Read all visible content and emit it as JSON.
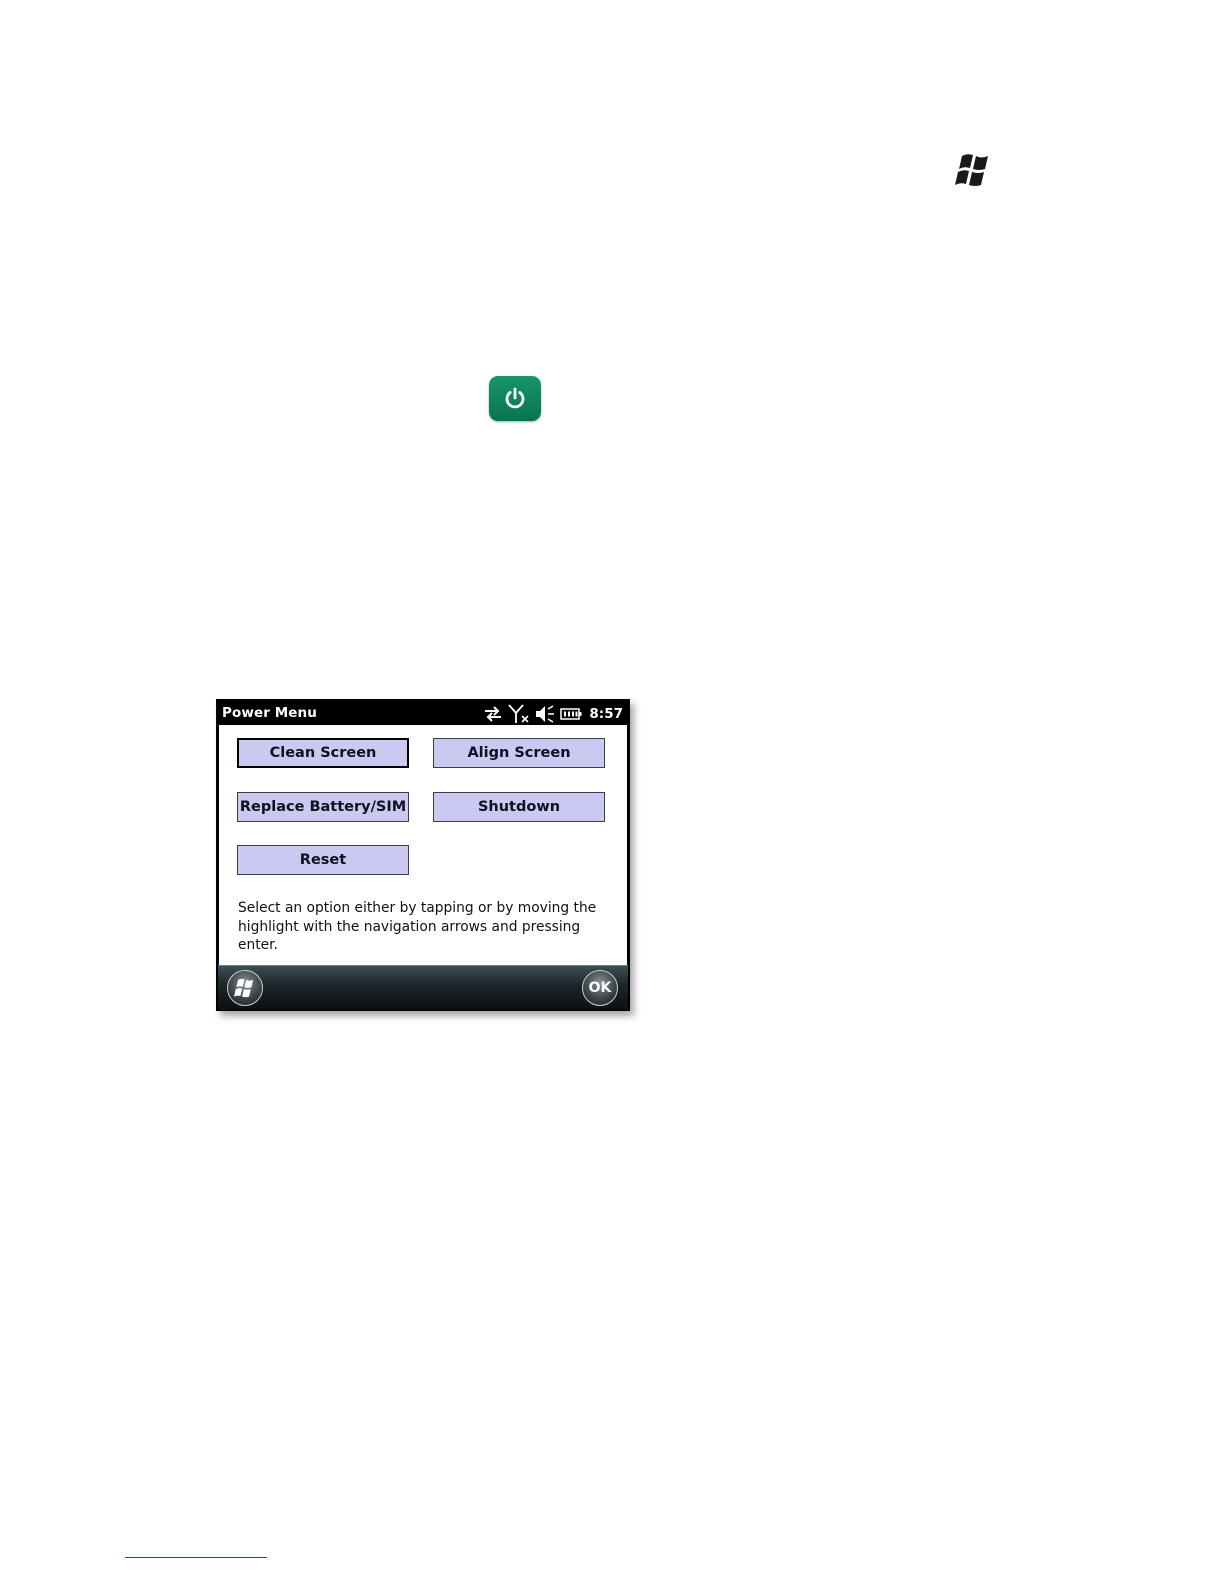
{
  "page": {
    "start_icon": "windows-flag-icon",
    "power_app_icon": "power-icon",
    "accent_green": "#0f8a63"
  },
  "screenshot": {
    "title": "Power Menu",
    "status": {
      "clock": "8:57",
      "icons": [
        "sync-arrows-icon",
        "signal-off-icon",
        "speaker-muted-icon",
        "battery-icon"
      ]
    },
    "buttons": {
      "clean_screen": "Clean Screen",
      "align_screen": "Align Screen",
      "replace_battery": "Replace Battery/SIM",
      "shutdown": "Shutdown",
      "reset": "Reset"
    },
    "instructions": "Select an option either by tapping or by moving the highlight with the navigation arrows and pressing enter.",
    "softkeys": {
      "start_icon": "windows-start-icon",
      "ok": "OK"
    },
    "button_color": "#c9c9f2"
  }
}
